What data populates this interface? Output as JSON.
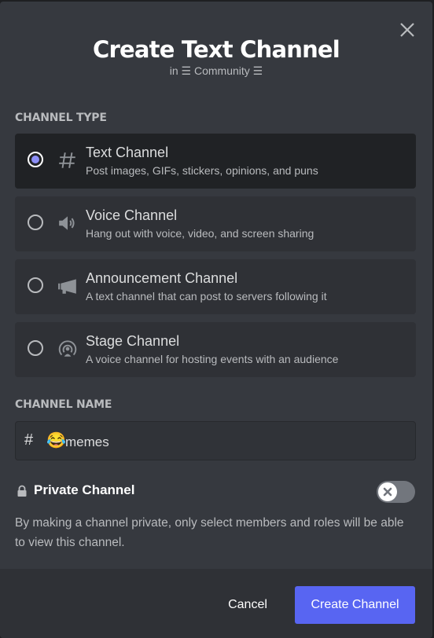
{
  "modal": {
    "title": "Create Text Channel",
    "subtitle": "in ☰ Community ☰",
    "close_icon": "close-icon"
  },
  "channel_type": {
    "label": "CHANNEL TYPE",
    "selected": "text",
    "options": [
      {
        "id": "text",
        "label": "Text Channel",
        "description": "Post images, GIFs, stickers, opinions, and puns",
        "icon": "hash-icon",
        "selected": true
      },
      {
        "id": "voice",
        "label": "Voice Channel",
        "description": "Hang out with voice, video, and screen sharing",
        "icon": "speaker-icon",
        "selected": false
      },
      {
        "id": "announcement",
        "label": "Announcement Channel",
        "description": "A text channel that can post to servers following it",
        "icon": "megaphone-icon",
        "selected": false
      },
      {
        "id": "stage",
        "label": "Stage Channel",
        "description": "A voice channel for hosting events with an audience",
        "icon": "stage-icon",
        "selected": false
      }
    ]
  },
  "channel_name": {
    "label": "CHANNEL NAME",
    "prefix": "#",
    "emoji": "😂",
    "value": "memes"
  },
  "private_channel": {
    "label": "Private Channel",
    "enabled": false,
    "description": "By making a channel private, only select members and roles will be able to view this channel."
  },
  "footer": {
    "cancel_label": "Cancel",
    "create_label": "Create Channel"
  },
  "colors": {
    "accent": "#5865f2",
    "radio_selected": "#8c8ef5",
    "background": "#36393f"
  }
}
